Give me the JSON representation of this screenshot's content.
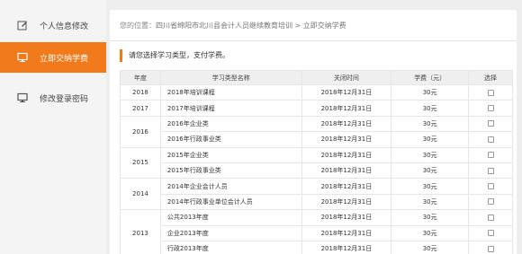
{
  "sidebar": {
    "items": [
      {
        "label": "个人信息修改",
        "icon": "edit-icon",
        "active": false
      },
      {
        "label": "立即交纳学费",
        "icon": "monitor-icon",
        "active": true
      },
      {
        "label": "修改登录密码",
        "icon": "monitor-icon",
        "active": false
      }
    ]
  },
  "breadcrumb": {
    "prefix": "您的位置：",
    "path": "四川省绵阳市北川县会计人员继续教育培训 > 立即交纳学费"
  },
  "notice": "请您选择学习类型，支付学费。",
  "accent_color": "#f27a1a",
  "table": {
    "headers": [
      "年度",
      "学习类型名称",
      "关闭时间",
      "学费（元）",
      "选择"
    ],
    "rows": [
      {
        "year": "2018",
        "name": "2018年培训课程",
        "close": "2018年12月31日",
        "fee": "30元"
      },
      {
        "year": "2017",
        "name": "2017年培训课程",
        "close": "2018年12月31日",
        "fee": "30元"
      },
      {
        "year": "2016",
        "name": "2016年企业类",
        "close": "2018年12月31日",
        "fee": "30元"
      },
      {
        "year": "",
        "name": "2016年行政事业类",
        "close": "2018年12月31日",
        "fee": "30元"
      },
      {
        "year": "2015",
        "name": "2015年企业类",
        "close": "2018年12月31日",
        "fee": "30元"
      },
      {
        "year": "",
        "name": "2015年行政事业类",
        "close": "2018年12月31日",
        "fee": "30元"
      },
      {
        "year": "2014",
        "name": "2014年企业会计人员",
        "close": "2018年12月31日",
        "fee": "30元"
      },
      {
        "year": "",
        "name": "2014年行政事业单位会计人员",
        "close": "2018年12月31日",
        "fee": "30元"
      },
      {
        "year": "2013",
        "name": "公共2013年度",
        "close": "2018年12月31日",
        "fee": "30元"
      },
      {
        "year": "",
        "name": "企业2013年度",
        "close": "2018年12月31日",
        "fee": "30元"
      },
      {
        "year": "",
        "name": "行政2013年度",
        "close": "2018年12月31日",
        "fee": "30元"
      }
    ]
  }
}
